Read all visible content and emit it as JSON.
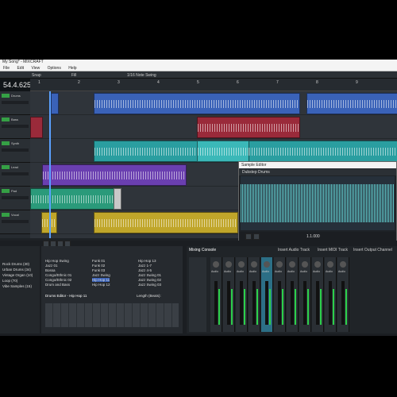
{
  "app": {
    "title": "My Song* - MIXCRAFT"
  },
  "menu": [
    "File",
    "Edit",
    "View",
    "Options",
    "Help"
  ],
  "toolbar": {
    "snap": "Snap",
    "mode": "Fill",
    "quantize": "1/16 Note Swing"
  },
  "transport": {
    "time": "54.4.625"
  },
  "ruler": {
    "marks": [
      "1",
      "2",
      "3",
      "4",
      "5",
      "6",
      "7",
      "8",
      "9"
    ]
  },
  "tracks": [
    {
      "name": "Drums"
    },
    {
      "name": "Bass"
    },
    {
      "name": "Synth"
    },
    {
      "name": "Lead"
    },
    {
      "name": "Pad"
    },
    {
      "name": "Vocal"
    }
  ],
  "editor": {
    "title": "Sample Editor",
    "clip_name": "Dubstep Drums",
    "time": "1.1.000"
  },
  "browser": {
    "items": [
      "Rock Drums (30)",
      "Urban Drums (34)",
      "Vintage Organ (10)",
      "Loop (70)",
      "Vibe Samples (15)"
    ]
  },
  "drums": {
    "header": "Drums Editor - Hip Hop 11",
    "length_label": "Length (Beats):",
    "styles": [
      "Hip Hop Swing",
      "Jazz 01",
      "Bossa",
      "Congo/Ethnic 01",
      "Congo/Ethnic 02",
      "Drum and Bass"
    ],
    "kits": [
      "Funk 01",
      "Funk 02",
      "Funk 03",
      "Jazz Swing",
      "Hip Hop 11",
      "Hip Hop 12"
    ],
    "patterns": [
      "Hip Hop 13",
      "Jazz 1-7",
      "Jazz 4-5",
      "Jazz Swing 01",
      "Jazz Swing 02",
      "Jazz Swing 03"
    ]
  },
  "mixer": {
    "title": "Mixing Console",
    "tabs": [
      "Insert Audio Track",
      "Insert MIDI Track",
      "Insert Output Channel"
    ],
    "channels": [
      "Audio",
      "Audio",
      "Audio",
      "Audio",
      "Audio",
      "Audio",
      "Audio",
      "Audio",
      "Audio",
      "Audio",
      "Audio"
    ]
  },
  "colors": {
    "accent": "#5aa0ff",
    "clip_blue": "#3a62b8",
    "clip_red": "#9a2a3a",
    "clip_teal": "#2a9ea0",
    "clip_purple": "#6a3fb0",
    "clip_green": "#2a9a7a",
    "clip_yellow": "#c0a62a"
  }
}
